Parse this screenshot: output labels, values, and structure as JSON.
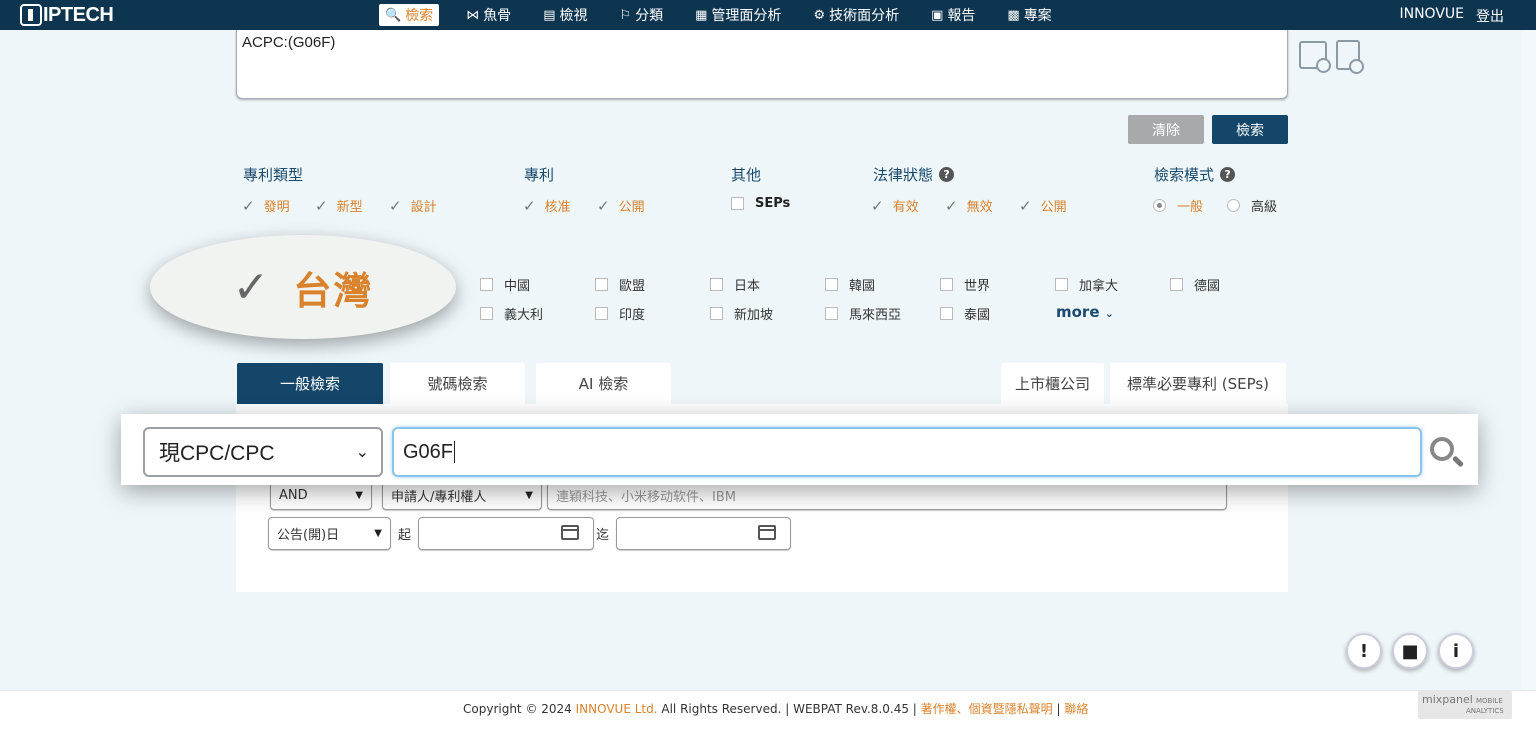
{
  "nav": {
    "logo": "IPTECH",
    "items": [
      {
        "label": "檢索",
        "icon": "search-icon",
        "active": true
      },
      {
        "label": "魚骨",
        "icon": "fishbone-icon"
      },
      {
        "label": "檢視",
        "icon": "list-icon"
      },
      {
        "label": "分類",
        "icon": "classify-icon"
      },
      {
        "label": "管理面分析",
        "icon": "management-chart-icon"
      },
      {
        "label": "技術面分析",
        "icon": "tech-gears-icon"
      },
      {
        "label": "報告",
        "icon": "report-icon"
      },
      {
        "label": "專案",
        "icon": "project-icon"
      }
    ],
    "user": "INNOVUE",
    "logout": "登出"
  },
  "query": {
    "text": "ACPC:(G06F)"
  },
  "buttons": {
    "clear": "清除",
    "search": "檢索"
  },
  "filters": {
    "patent_type": {
      "title": "專利類型",
      "options": [
        "發明",
        "新型",
        "設計"
      ]
    },
    "patent": {
      "title": "專利",
      "options": [
        "核准",
        "公開"
      ]
    },
    "other": {
      "title": "其他",
      "options": [
        "SEPs"
      ]
    },
    "legal_status": {
      "title": "法律狀態",
      "options": [
        "有效",
        "無效",
        "公開"
      ]
    },
    "search_mode": {
      "title": "檢索模式",
      "options": [
        "一般",
        "高級"
      ],
      "selected": "一般"
    }
  },
  "countries": {
    "highlighted": "台灣",
    "row1": [
      "中國",
      "歐盟",
      "日本",
      "韓國",
      "世界",
      "加拿大",
      "德國"
    ],
    "row2": [
      "義大利",
      "印度",
      "新加坡",
      "馬來西亞",
      "泰國"
    ],
    "more": "more"
  },
  "tabs": [
    "一般檢索",
    "號碼檢索",
    "AI 檢索"
  ],
  "right_tabs": [
    "上市櫃公司",
    "標準必要專利 (SEPs)"
  ],
  "search_row": {
    "field": "現CPC/CPC",
    "value": "G06F"
  },
  "row2": {
    "op": "AND",
    "field": "申請人/專利權人",
    "placeholder": "連穎科技、小米移动软件、IBM"
  },
  "row3": {
    "date_field": "公告(開)日",
    "from": "起",
    "to": "迄"
  },
  "footer": {
    "prefix": "Copyright © 2024 ",
    "org": "INNOVUE Ltd.",
    "suffix": " All Rights Reserved. | WEBPAT Rev.8.0.45 | ",
    "links": "著作權、個資暨隱私聲明",
    "sep": " | ",
    "contact": "聯絡"
  },
  "mixpanel": {
    "brand": "mixpanel",
    "tag1": "MOBILE",
    "tag2": "ANALYTICS"
  },
  "colors": {
    "nav_bg": "#0e3550",
    "accent": "#d9822b",
    "primary": "#14466a"
  }
}
